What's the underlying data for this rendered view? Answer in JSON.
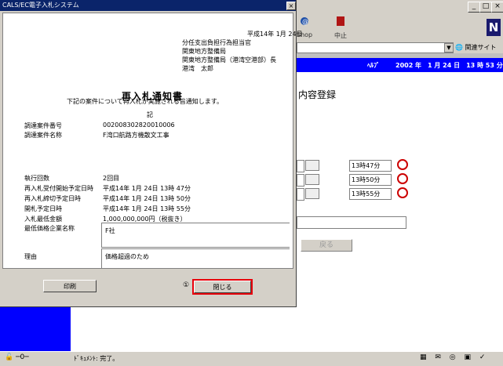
{
  "window": {
    "title": "CALS/EC電子入札システム"
  },
  "browser": {
    "toolbar": {
      "shop_label": "Shop",
      "stop_label": "中止"
    },
    "related_sites": "関連サイト",
    "header": {
      "help": "ﾍﾙﾌﾟ",
      "datetime": "2002 年　1 月 24 日　13 時 53 分"
    },
    "heading": "内容登録",
    "times": [
      "13時47分",
      "13時50分",
      "13時55分"
    ],
    "back_button": "戻る",
    "status": "ﾄﾞｷｭﾒﾝﾄ: 完了。"
  },
  "notice": {
    "date": "平成14年 1月 24日",
    "sender": [
      "分任支出負担行為担当官",
      "関東地方整備局",
      "関東地方整備局（港湾空港部）長",
      "港湾　太郎"
    ],
    "title": "再入札通知書",
    "intro": "下記の案件について再入札が実施される旨通知します。",
    "ki": "記",
    "fields": [
      {
        "label": "調達案件番号",
        "value": "002008302820010006"
      },
      {
        "label": "調達案件名称",
        "value": "F湾口航路方機散文工事"
      },
      {
        "label": "執行回数",
        "value": "2回目"
      },
      {
        "label": "再入札受付開始予定日時",
        "value": "平成14年 1月 24日 13時 47分"
      },
      {
        "label": "再入札締切予定日時",
        "value": "平成14年 1月 24日 13時 50分"
      },
      {
        "label": "開札予定日時",
        "value": "平成14年 1月 24日 13時 55分"
      },
      {
        "label": "入札最低金額",
        "value": "1,000,000,000円（税抜き）"
      }
    ],
    "lowest_company_label": "最低価格企業名称",
    "lowest_company_value": "F社",
    "reason_label": "理由",
    "reason_value": "価格超過のため"
  },
  "buttons": {
    "print": "印刷",
    "close": "閉じる"
  },
  "annotation": {
    "step": "①"
  }
}
